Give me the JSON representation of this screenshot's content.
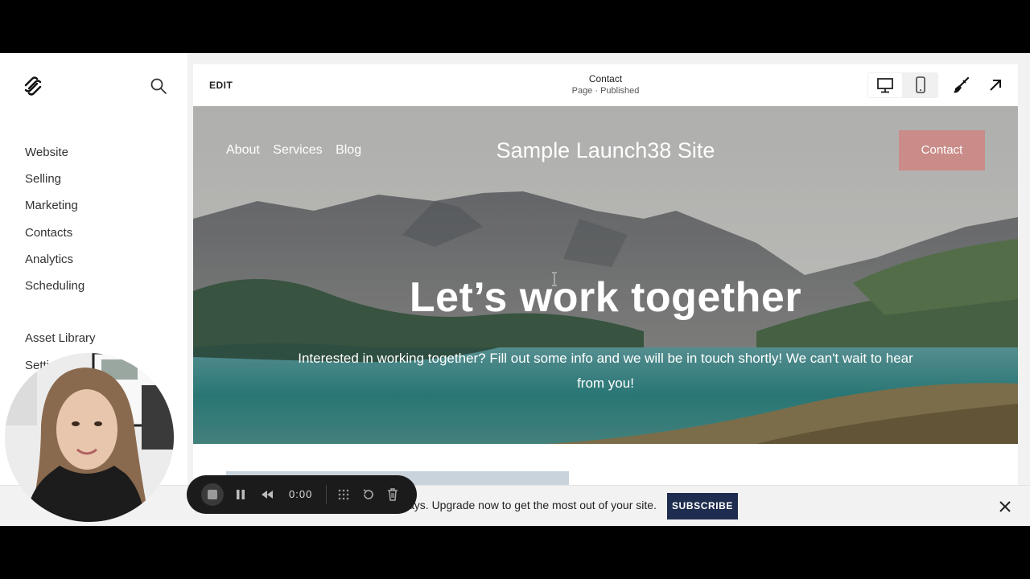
{
  "sidebar": {
    "nav": [
      "Website",
      "Selling",
      "Marketing",
      "Contacts",
      "Analytics",
      "Scheduling"
    ],
    "asset_library": "Asset Library",
    "settings_partial": "Setti"
  },
  "editor": {
    "edit_label": "EDIT",
    "page_name": "Contact",
    "page_status": "Page · Published"
  },
  "site": {
    "nav": [
      "About",
      "Services",
      "Blog"
    ],
    "title": "Sample Launch38 Site",
    "cta": "Contact",
    "headline": "Let’s work together",
    "body": "Interested in working together? Fill out some info and we will be in touch shortly! We can't wait to hear from you!"
  },
  "banner": {
    "text": "ays. Upgrade now to get the most out of your site.",
    "subscribe": "SUBSCRIBE"
  },
  "recorder": {
    "time": "0:00"
  },
  "colors": {
    "accent_cta": "#c98c88",
    "subscribe_bg": "#1e2d4f"
  }
}
